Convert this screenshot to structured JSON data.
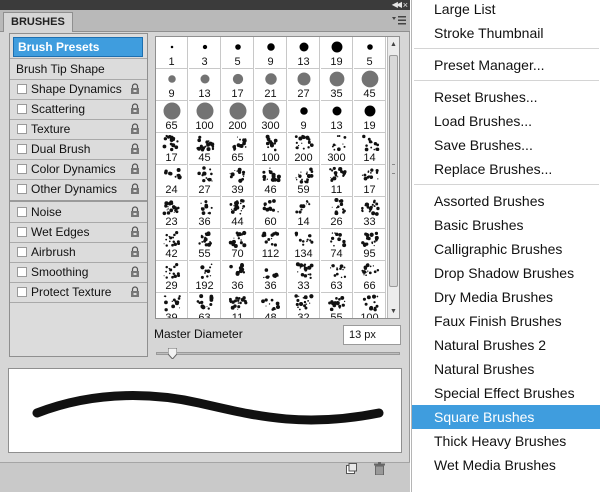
{
  "panel": {
    "tab_title": "BRUSHES",
    "options": {
      "presets_label": "Brush Presets",
      "tip_shape_label": "Brush Tip Shape",
      "group1": [
        "Shape Dynamics",
        "Scattering",
        "Texture",
        "Dual Brush",
        "Color Dynamics",
        "Other Dynamics"
      ],
      "group2": [
        "Noise",
        "Wet Edges",
        "Airbrush",
        "Smoothing",
        "Protect Texture"
      ]
    },
    "grid_values": [
      "1",
      "3",
      "5",
      "9",
      "13",
      "19",
      "5",
      "9",
      "13",
      "17",
      "21",
      "27",
      "35",
      "45",
      "65",
      "100",
      "200",
      "300",
      "9",
      "13",
      "19",
      "17",
      "45",
      "65",
      "100",
      "200",
      "300",
      "14",
      "24",
      "27",
      "39",
      "46",
      "59",
      "11",
      "17",
      "23",
      "36",
      "44",
      "60",
      "14",
      "26",
      "33",
      "42",
      "55",
      "70",
      "112",
      "134",
      "74",
      "95",
      "29",
      "192",
      "36",
      "36",
      "33",
      "63",
      "66",
      "39",
      "63",
      "11",
      "48",
      "32",
      "55",
      "100"
    ],
    "master_diameter_label": "Master Diameter",
    "master_diameter_value": "13 px",
    "master_diameter_fraction": 0.01,
    "icons": {
      "collapse": "collapse-panel-icon",
      "close": "close-icon",
      "panel_menu": "panel-menu-icon",
      "lock": "lock-icon",
      "new_preset": "new-brush-preset-icon",
      "trash": "trash-icon"
    }
  },
  "flyout_menu": {
    "items": [
      {
        "label": "Large List"
      },
      {
        "label": "Stroke Thumbnail"
      },
      {
        "separator": true
      },
      {
        "label": "Preset Manager..."
      },
      {
        "separator": true
      },
      {
        "label": "Reset Brushes..."
      },
      {
        "label": "Load Brushes..."
      },
      {
        "label": "Save Brushes..."
      },
      {
        "label": "Replace Brushes..."
      },
      {
        "separator": true
      },
      {
        "label": "Assorted Brushes"
      },
      {
        "label": "Basic Brushes"
      },
      {
        "label": "Calligraphic Brushes"
      },
      {
        "label": "Drop Shadow Brushes"
      },
      {
        "label": "Dry Media Brushes"
      },
      {
        "label": "Faux Finish Brushes"
      },
      {
        "label": "Natural Brushes 2"
      },
      {
        "label": "Natural Brushes"
      },
      {
        "label": "Special Effect Brushes"
      },
      {
        "label": "Square Brushes",
        "selected": true
      },
      {
        "label": "Thick Heavy Brushes"
      },
      {
        "label": "Wet Media Brushes"
      }
    ]
  },
  "colors": {
    "selection": "#3f9dde",
    "panel_bg": "#d6d6d6",
    "title_bar": "#3b3b3b"
  }
}
